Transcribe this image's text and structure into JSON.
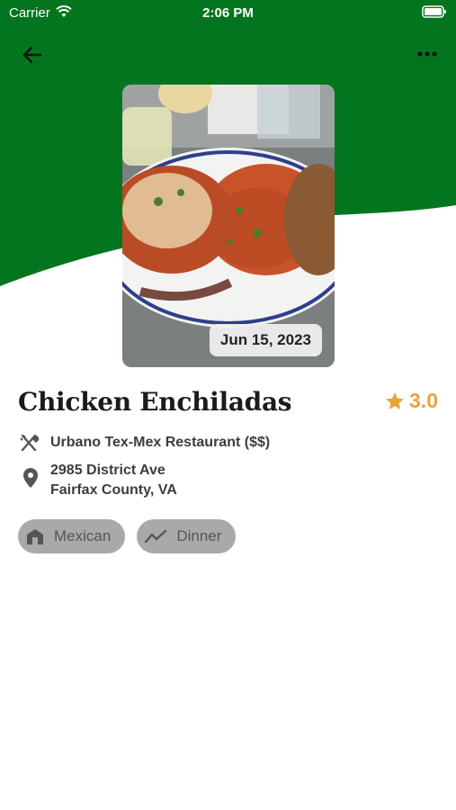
{
  "status_bar": {
    "carrier": "Carrier",
    "time": "2:06 PM"
  },
  "colors": {
    "header_green": "#03751e",
    "rating_star": "#e8a33a",
    "chip_bg": "#a9a9a9"
  },
  "photo": {
    "date_label": "Jun 15, 2023"
  },
  "dish": {
    "title": "Chicken Enchiladas",
    "rating": "3.0"
  },
  "details": {
    "restaurant": "Urbano Tex-Mex Restaurant ($$)",
    "address_line1": "2985 District Ave",
    "address_line2": "Fairfax County, VA"
  },
  "tags": [
    {
      "label": "Mexican",
      "icon": "restaurant-building-icon"
    },
    {
      "label": "Dinner",
      "icon": "trend-line-icon"
    }
  ]
}
